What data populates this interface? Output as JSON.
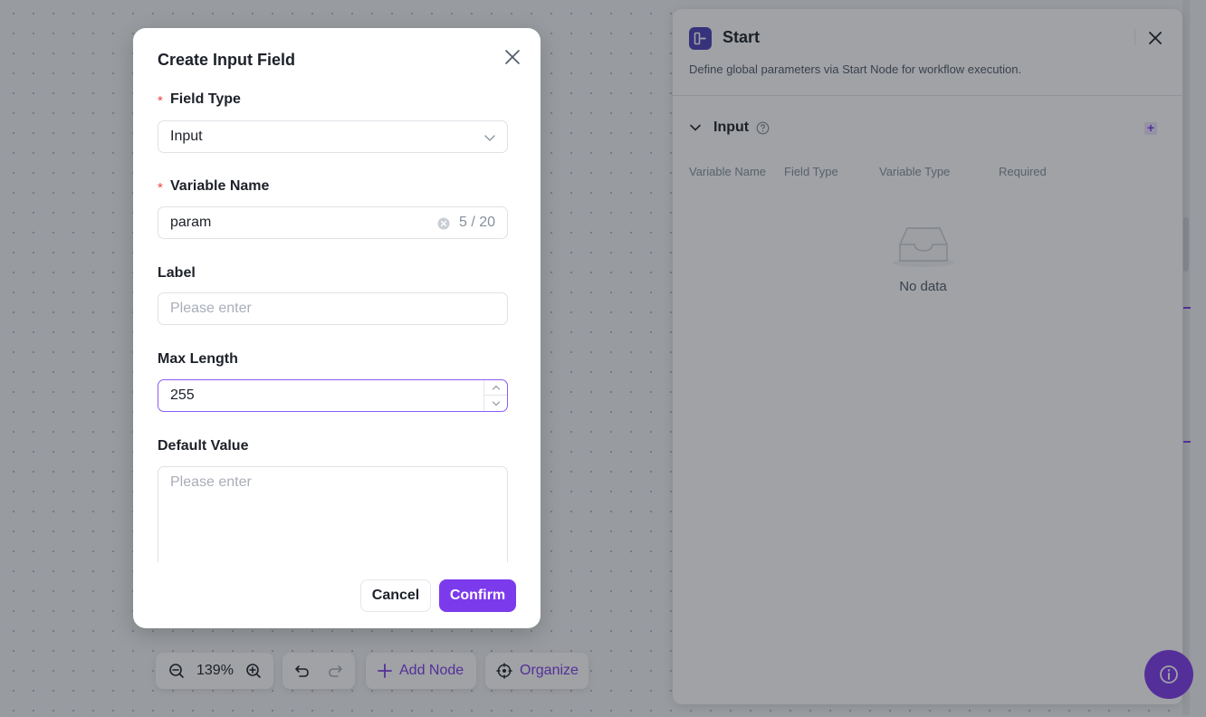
{
  "canvas": {
    "zoom_label": "139%",
    "add_node_label": "Add Node",
    "organize_label": "Organize"
  },
  "panel": {
    "title": "Start",
    "description": "Define global parameters via Start Node for workflow execution.",
    "section_title": "Input",
    "columns": [
      "Variable Name",
      "Field Type",
      "Variable Type",
      "Required"
    ],
    "empty_text": "No data"
  },
  "modal": {
    "title": "Create Input Field",
    "field_type": {
      "label": "Field Type",
      "value": "Input"
    },
    "variable_name": {
      "label": "Variable Name",
      "value": "param",
      "counter": "5 / 20"
    },
    "label_field": {
      "label": "Label",
      "placeholder": "Please enter"
    },
    "max_length": {
      "label": "Max Length",
      "value": "255"
    },
    "default_value": {
      "label": "Default Value",
      "placeholder": "Please enter"
    },
    "cancel_label": "Cancel",
    "confirm_label": "Confirm"
  },
  "colors": {
    "accent": "#7c3aed",
    "required_star": "#f53f3f",
    "logo": "#4b3fb8"
  }
}
